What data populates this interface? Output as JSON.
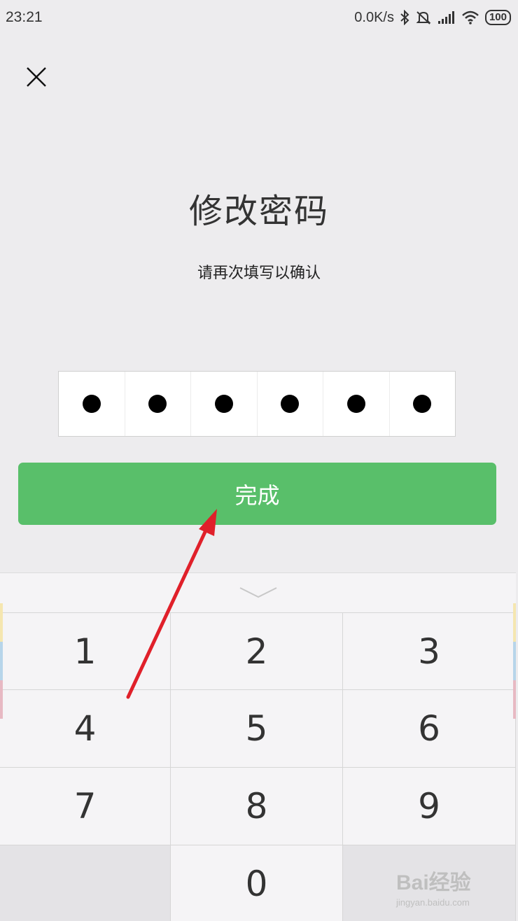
{
  "status_bar": {
    "time": "23:21",
    "net_speed": "0.0K/s",
    "battery": "100",
    "icons": [
      "bluetooth-icon",
      "mute-icon",
      "signal-icon",
      "wifi-icon",
      "battery-icon"
    ]
  },
  "header": {
    "close_icon": "close-icon",
    "title": "修改密码",
    "subtitle": "请再次填写以确认"
  },
  "pin": {
    "length": 6,
    "filled": 6
  },
  "done_button": {
    "label": "完成",
    "color": "#59bf6a"
  },
  "keypad": {
    "collapse_icon": "chevron-down-icon",
    "keys": [
      "1",
      "2",
      "3",
      "4",
      "5",
      "6",
      "7",
      "8",
      "9",
      "",
      "0",
      ""
    ]
  },
  "annotation": {
    "arrow_color": "#e0202a"
  },
  "watermark": {
    "brand": "Bai经验",
    "url": "jingyan.baidu.com"
  }
}
